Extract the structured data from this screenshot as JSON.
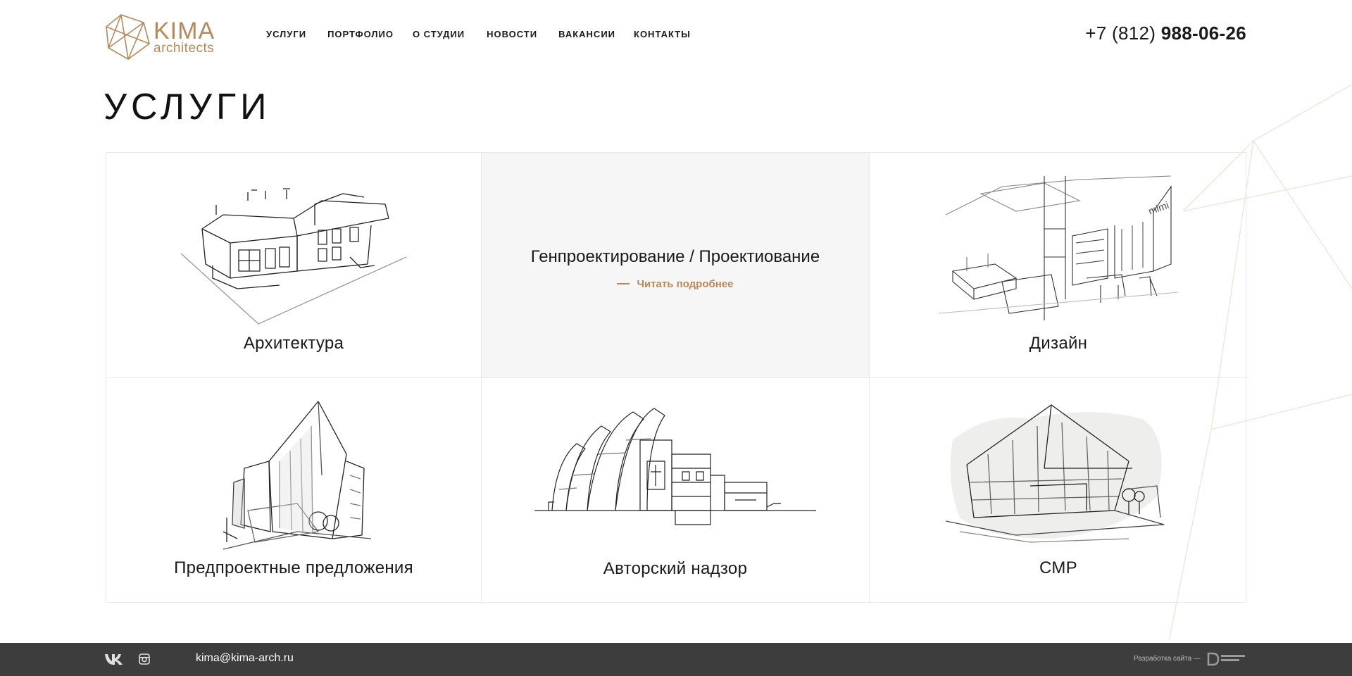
{
  "header": {
    "logo": {
      "line1": "KIMA",
      "line2": "architects"
    },
    "nav": [
      {
        "label": "УСЛУГИ"
      },
      {
        "label": "ПОРТФОЛИО"
      },
      {
        "label": "О СТУДИИ"
      },
      {
        "label": "НОВОСТИ"
      },
      {
        "label": "ВАКАНСИИ"
      },
      {
        "label": "КОНТАКТЫ"
      }
    ],
    "phone": {
      "prefix": "+7 (812) ",
      "number": "988-06-26"
    }
  },
  "page_title": "УСЛУГИ",
  "services": [
    {
      "label": "Архитектура",
      "icon": "house-sketch-icon"
    },
    {
      "label": "Генпроектирование / Проектиование",
      "more": "Читать подробнее"
    },
    {
      "label": "Дизайн",
      "icon": "interior-sketch-icon"
    },
    {
      "label": "Предпроектные предложения",
      "icon": "towers-sketch-icon"
    },
    {
      "label": "Авторский надзор",
      "icon": "church-sketch-icon"
    },
    {
      "label": "СМР",
      "icon": "villa-sketch-icon"
    }
  ],
  "footer": {
    "social": [
      "vk-icon",
      "instagram-icon"
    ],
    "email": "kima@kima-arch.ru",
    "dev_label": "Разработка сайта —",
    "dev_logo": "dobohov-design-logo"
  },
  "colors": {
    "accent": "#b5895a",
    "footer_bg": "#3d3d3d",
    "hover_bg": "#f6f6f6"
  }
}
